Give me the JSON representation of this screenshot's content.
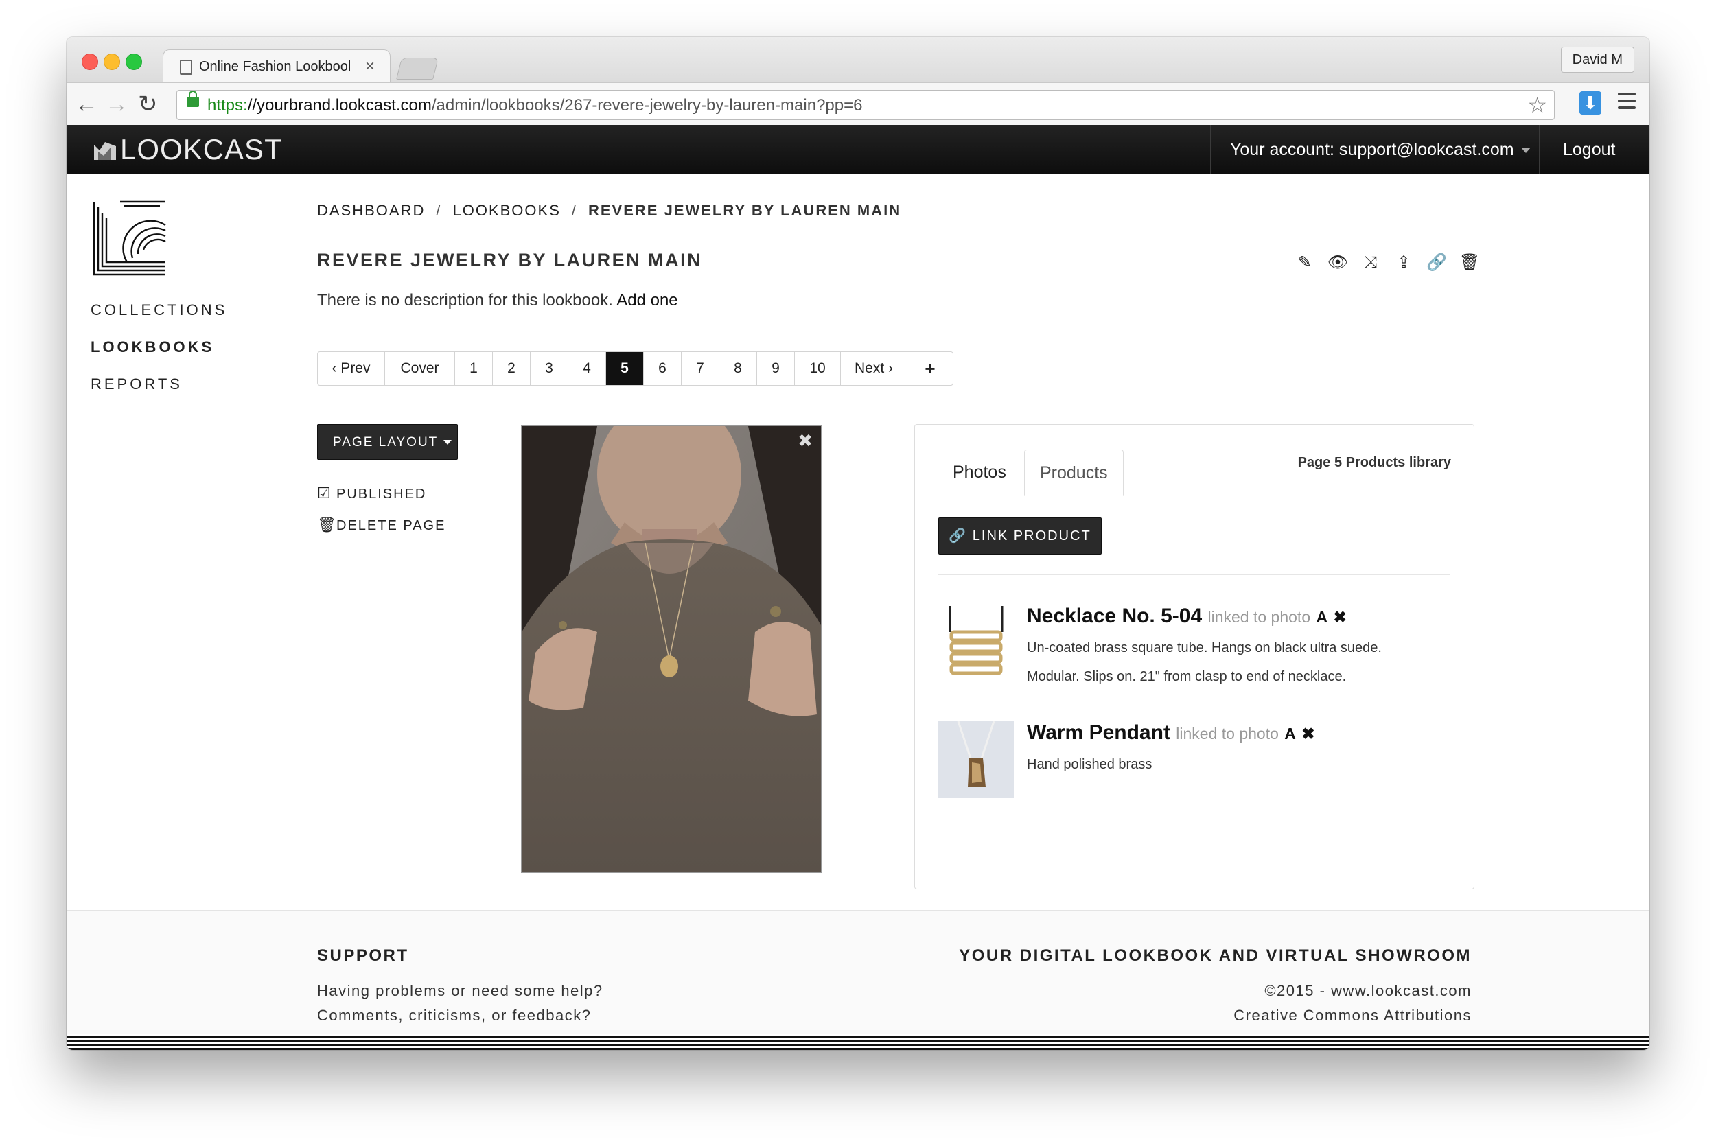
{
  "browser": {
    "tab_title": "Online Fashion Lookbook |",
    "profile_name": "David M",
    "url_scheme": "https:",
    "url_host": "//yourbrand.lookcast.com",
    "url_path": "/admin/lookbooks/267-revere-jewelry-by-lauren-main?pp=6"
  },
  "header": {
    "brand": "LOOKCAST",
    "account_label": "Your account: support@lookcast.com",
    "logout_label": "Logout"
  },
  "sidebar": {
    "items": [
      {
        "label": "COLLECTIONS"
      },
      {
        "label": "LOOKBOOKS"
      },
      {
        "label": "REPORTS"
      }
    ]
  },
  "breadcrumb": {
    "items": [
      "DASHBOARD",
      "LOOKBOOKS",
      "REVERE JEWELRY BY LAUREN MAIN"
    ],
    "separator": "/"
  },
  "lookbook": {
    "title": "REVERE JEWELRY BY LAUREN MAIN",
    "description": "There is no description for this lookbook.",
    "add_link": "Add one"
  },
  "pager": {
    "prev": "‹ Prev",
    "cover": "Cover",
    "pages": [
      "1",
      "2",
      "3",
      "4",
      "5",
      "6",
      "7",
      "8",
      "9",
      "10"
    ],
    "active_page": "5",
    "next": "Next ›",
    "add": "+"
  },
  "page_controls": {
    "layout_button": "PAGE LAYOUT",
    "published": "PUBLISHED",
    "delete_page": "DELETE PAGE"
  },
  "products_panel": {
    "tab_photos": "Photos",
    "tab_products": "Products",
    "library_label": "Page 5 Products library",
    "link_button": "LINK PRODUCT",
    "products": [
      {
        "name": "Necklace No. 5-04",
        "linked_text": "linked to photo",
        "photo": "A",
        "desc_line1": "Un-coated brass square tube. Hangs on black ultra suede.",
        "desc_line2": "Modular. Slips on. 21\" from clasp to end of necklace."
      },
      {
        "name": "Warm Pendant",
        "linked_text": "linked to photo",
        "photo": "A",
        "desc_line1": "Hand polished brass"
      }
    ]
  },
  "footer": {
    "support_heading": "SUPPORT",
    "support_line1": "Having problems or need some help?",
    "support_line2": "Comments, criticisms, or feedback?",
    "tagline": "YOUR DIGITAL LOOKBOOK AND VIRTUAL SHOWROOM",
    "copyright": "©2015 - www.lookcast.com",
    "license": "Creative Commons Attributions"
  },
  "colors": {
    "accent_dark": "#111111",
    "url_secure": "#1a8a1a",
    "download_blue": "#3892e0"
  }
}
